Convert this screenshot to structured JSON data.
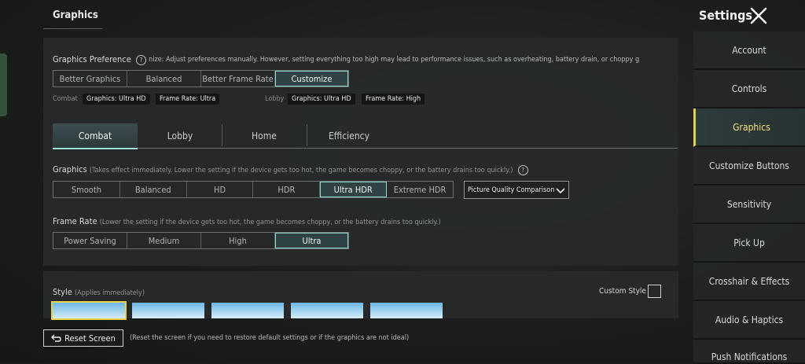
{
  "header": {
    "section_title": "Graphics",
    "settings_title": "Settings"
  },
  "preference": {
    "label": "Graphics Preference",
    "description": "nize: Adjust preferences manually. However, setting everything too high may lead to performance issues, such as overheating, battery drain, or choppy g",
    "options": [
      "Better Graphics",
      "Balanced",
      "Better Frame Rate",
      "Customize"
    ],
    "selected": "Customize",
    "combat_label": "Combat",
    "combat_chips": [
      "Graphics: Ultra HD",
      "Frame Rate: Ultra"
    ],
    "lobby_label": "Lobby",
    "lobby_chips": [
      "Graphics: Ultra HD",
      "Frame Rate: High"
    ]
  },
  "tabs": [
    "Combat",
    "Lobby",
    "Home",
    "Efficiency"
  ],
  "selected_tab": "Combat",
  "graphics": {
    "label": "Graphics",
    "note": "(Takes effect immediately. Lower the setting if the device gets too hot, the game becomes choppy, or the battery drains too quickly.)",
    "options": [
      "Smooth",
      "Balanced",
      "HD",
      "HDR",
      "Ultra HDR",
      "Extreme HDR"
    ],
    "selected": "Ultra HDR",
    "comparison_dropdown": "Picture Quality Comparison"
  },
  "frame_rate": {
    "label": "Frame Rate",
    "note": "(Lower the setting if the device gets too hot, the game becomes choppy, or the battery drains too quickly.)",
    "options": [
      "Power Saving",
      "Medium",
      "High",
      "Ultra"
    ],
    "selected": "Ultra"
  },
  "style": {
    "label": "Style",
    "note": "(Applies immediately)",
    "custom_style_label": "Custom Style",
    "custom_style_checked": false
  },
  "reset": {
    "button_label": "Reset Screen",
    "note": "(Reset the screen if you need to restore default settings or if the graphics are not ideal)"
  },
  "sidebar": {
    "items": [
      "Account",
      "Controls",
      "Graphics",
      "Customize Buttons",
      "Sensitivity",
      "Pick Up",
      "Crosshair & Effects",
      "Audio & Haptics",
      "Push Notifications"
    ],
    "selected": "Graphics"
  },
  "colors": {
    "accent_teal": "#8fd6cf",
    "accent_yellow": "#e3cf53"
  },
  "icons": [
    "close-icon",
    "help-icon",
    "chevron-down-icon",
    "reset-arrow-icon"
  ]
}
